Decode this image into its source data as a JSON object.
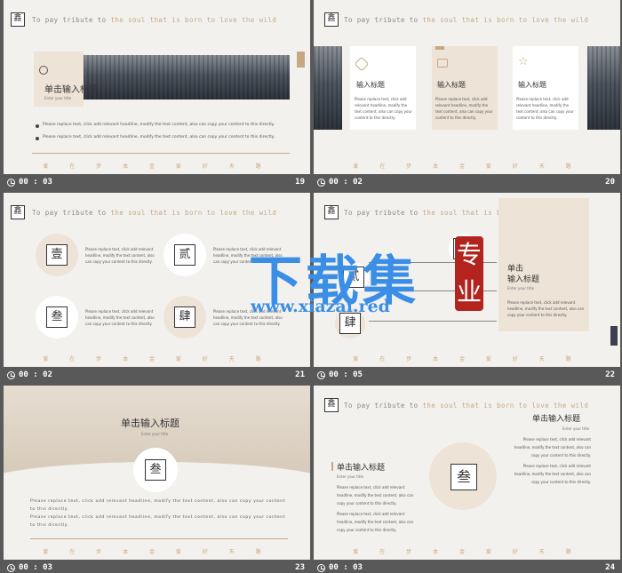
{
  "tagline": {
    "part1": "To pay tribute to ",
    "part2": "the soul that is born to love the wild"
  },
  "logo_char": "鑫",
  "bottom_chars": "爱 在 步 本 金 爱 好 天 路",
  "placeholder_text": "Please replace text, click add relevant headline, modify the text content, also can copy your content to this directly.",
  "placeholder_short": "Please replace text, click add relevant headline, modify the text content, also can copy your content to this directly.",
  "title_cn": "单击输入标题",
  "title_cn_two_line": {
    "line1": "单击",
    "line2": "输入标题"
  },
  "input_heading": "输入标题",
  "enter_title": "Enter your title",
  "enter_title_small": "Enter your title",
  "seal_chars": {
    "one": "壹",
    "two": "贰",
    "three": "叁",
    "four": "肆"
  },
  "thumbs": [
    {
      "time": "00 : 03",
      "num": "19"
    },
    {
      "time": "00 : 02",
      "num": "20"
    },
    {
      "time": "00 : 02",
      "num": "21"
    },
    {
      "time": "00 : 05",
      "num": "22"
    },
    {
      "time": "00 : 03",
      "num": "23"
    },
    {
      "time": "00 : 03",
      "num": "24"
    }
  ],
  "watermark": {
    "big": "下载集",
    "url": "www.xiazai.red",
    "stamp": "专业"
  },
  "colors": {
    "gold": "#c8a882",
    "beige": "#ede3d6",
    "bg": "#595959",
    "watermark": "#3a8ee6",
    "stamp": "#b3241f"
  }
}
